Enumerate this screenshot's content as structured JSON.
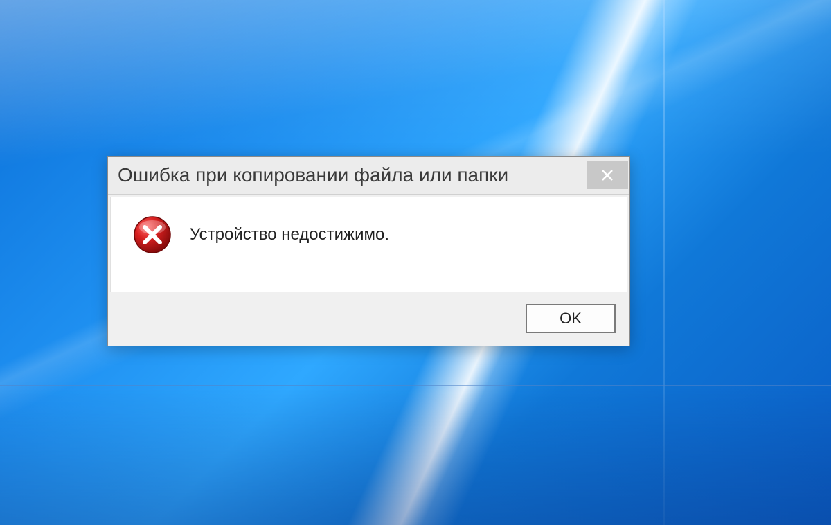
{
  "dialog": {
    "title": "Ошибка при копировании файла или папки",
    "message": "Устройство недостижимо.",
    "ok_label": "OK"
  }
}
